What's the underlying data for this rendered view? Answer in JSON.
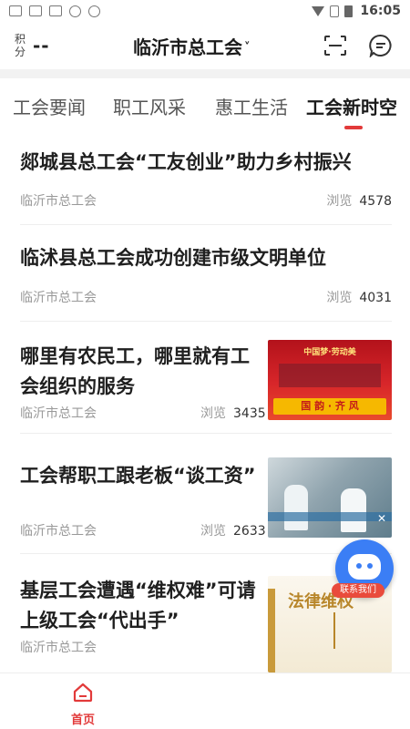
{
  "statusbar": {
    "time": "16:05"
  },
  "header": {
    "points_label_1": "积",
    "points_label_2": "分",
    "points_value": "--",
    "title": "临沂市总工会",
    "title_chevron": "˅"
  },
  "tabs": [
    {
      "label": "工会要闻"
    },
    {
      "label": "职工风采"
    },
    {
      "label": "惠工生活"
    },
    {
      "label": "工会新时空"
    }
  ],
  "articles": [
    {
      "title": "郯城县总工会“工友创业”助力乡村振兴",
      "source": "临沂市总工会",
      "views_label": "浏览",
      "views": "4578"
    },
    {
      "title": "临沭县总工会成功创建市级文明单位",
      "source": "临沂市总工会",
      "views_label": "浏览",
      "views": "4031"
    },
    {
      "title": "哪里有农民工，哪里就有工会组织的服务",
      "source": "临沂市总工会",
      "views_label": "浏览",
      "views": "3435"
    },
    {
      "title": "工会帮职工跟老板“谈工资”",
      "source": "临沂市总工会",
      "views_label": "浏览",
      "views": "2633"
    },
    {
      "title": "基层工会遭遇“维权难”可请上级工会“代出手”",
      "source": "临沂市总工会"
    }
  ],
  "thumbs": {
    "t3_banner": "中国梦·劳动美",
    "t3_sign": "国 韵 · 齐 风",
    "t5_text": "法律维权"
  },
  "bot": {
    "label": "联系我们"
  },
  "bottomnav": {
    "home_label": "首页"
  },
  "colors": {
    "accent": "#e23a3a",
    "bot": "#3b7ef5"
  }
}
